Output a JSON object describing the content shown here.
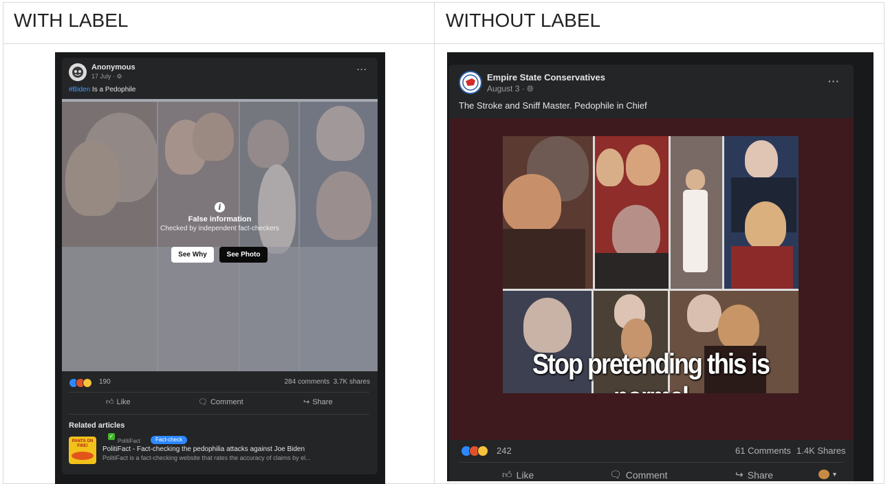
{
  "headers": {
    "with_label": "WITH LABEL",
    "without_label": "WITHOUT LABEL"
  },
  "left_post": {
    "author": "Anonymous",
    "date": "17 July",
    "hashtag": "#Biden",
    "text": " Is a  Pedophile",
    "overlay": {
      "title": "False information",
      "subtitle": "Checked by independent fact-checkers",
      "see_why": "See Why",
      "see_photo": "See Photo"
    },
    "reaction_count": "190",
    "comments_shares": "284 comments  3.7K shares",
    "actions": {
      "like": "Like",
      "comment": "Comment",
      "share": "Share"
    },
    "related": {
      "heading": "Related articles",
      "source": "PolitiFact",
      "badge": "Fact-check",
      "title": "PolitiFact - Fact-checking the pedophilia attacks against Joe Biden",
      "description": "PolitiFact is a fact-checking website that rates the accuracy of claims by el...",
      "thumb_text": "PANTS ON FIRE!"
    },
    "colors": {
      "badge": "#2d88ff",
      "link": "#4599ff"
    }
  },
  "right_post": {
    "author": "Empire State Conservatives",
    "date": "August 3",
    "text": "The Stroke and Sniff Master. Pedophile in Chief",
    "image_caption": "Stop pretending this is normal",
    "reaction_count": "242",
    "comments": "61 Comments",
    "shares": "1.4K Shares",
    "actions": {
      "like": "Like",
      "comment": "Comment",
      "share": "Share"
    },
    "colors": {
      "image_bg": "#3e1a1e",
      "caption": "#ffffff"
    }
  }
}
